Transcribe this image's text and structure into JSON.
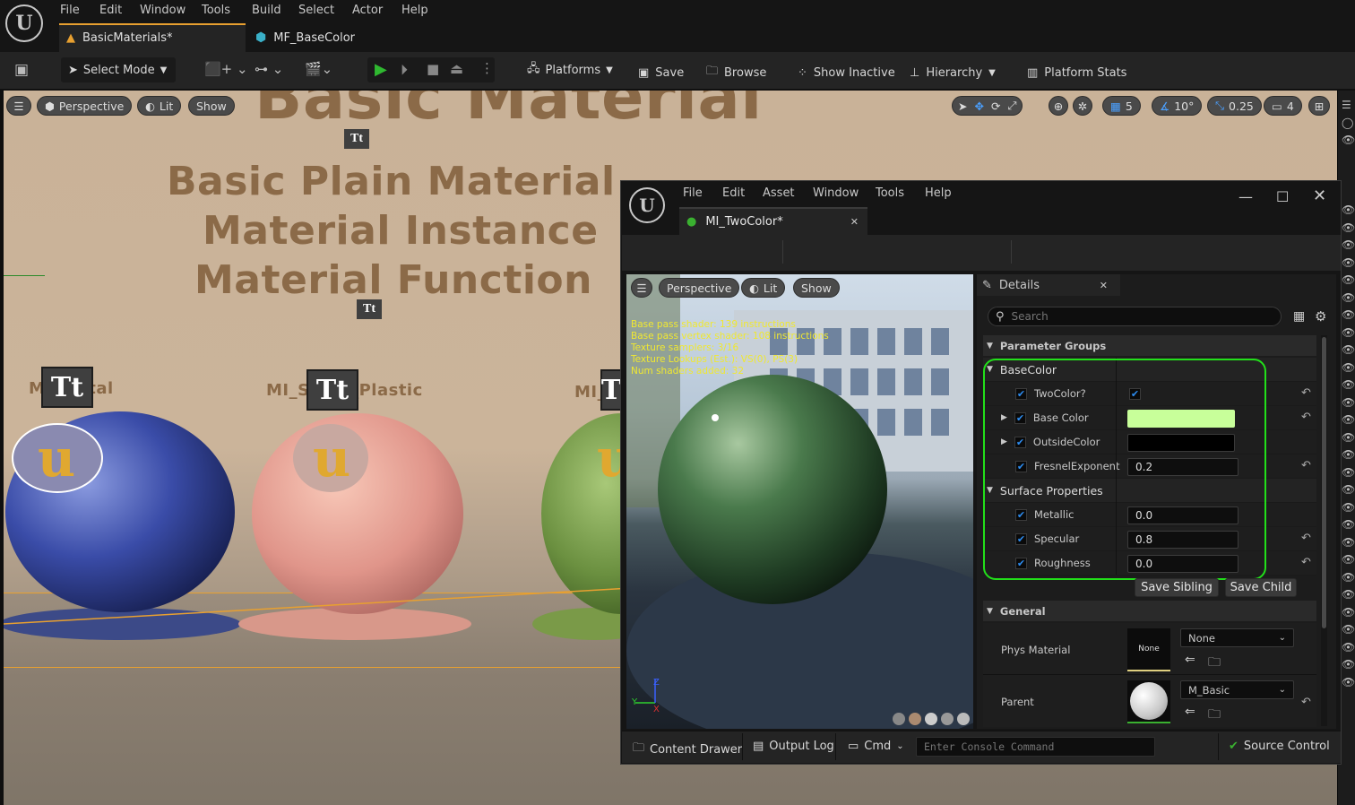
{
  "app": {
    "menu": [
      "File",
      "Edit",
      "Window",
      "Tools",
      "Build",
      "Select",
      "Actor",
      "Help"
    ],
    "tabs": [
      {
        "label": "BasicMaterials*"
      },
      {
        "label": "MF_BaseColor"
      }
    ]
  },
  "toolbar": {
    "select_mode": "Select Mode",
    "platforms": "Platforms"
  },
  "viewport": {
    "perspective": "Perspective",
    "lit": "Lit",
    "show": "Show",
    "snap_grid": "5",
    "snap_angle": "10°",
    "snap_scale": "0.25",
    "camera_speed": "4",
    "scene": {
      "heading": "Basic Material",
      "lines": [
        "Basic Plain Material",
        "Material Instance",
        "Material Function"
      ],
      "labels": [
        "MI_Metal",
        "MI_Shiny_Plastic",
        "MI_T"
      ]
    }
  },
  "material_editor": {
    "menu": [
      "File",
      "Edit",
      "Asset",
      "Window",
      "Tools",
      "Help"
    ],
    "tab": "MI_TwoColor*",
    "toolbar": {
      "save": "Save",
      "browse": "Browse",
      "show_inactive": "Show Inactive",
      "hierarchy": "Hierarchy",
      "platform_stats": "Platform Stats"
    },
    "preview": {
      "perspective": "Perspective",
      "lit": "Lit",
      "show": "Show",
      "stats": [
        "Base pass shader: 139 instructions",
        "Base pass vertex shader: 108 instructions",
        "Texture samplers: 3/16",
        "Texture Lookups (Est.): VS(0), PS(3)",
        "Num shaders added: 32"
      ]
    },
    "details": {
      "title": "Details",
      "search_placeholder": "Search",
      "parameter_groups": "Parameter Groups",
      "basecolor_group": "BaseColor",
      "params": [
        {
          "name": "TwoColor?",
          "value": ""
        },
        {
          "name": "Base Color",
          "value": ""
        },
        {
          "name": "OutsideColor",
          "value": ""
        },
        {
          "name": "FresnelExponent",
          "value": "0.2"
        }
      ],
      "surface_group": "Surface Properties",
      "surface": [
        {
          "name": "Metallic",
          "value": "0.0"
        },
        {
          "name": "Specular",
          "value": "0.8"
        },
        {
          "name": "Roughness",
          "value": "0.0"
        }
      ],
      "save_sibling": "Save Sibling",
      "save_child": "Save Child",
      "general": "General",
      "phys_material": "Phys Material",
      "phys_thumb": "None",
      "phys_value": "None",
      "parent": "Parent",
      "parent_value": "M_Basic"
    },
    "bottom": {
      "content_drawer": "Content Drawer",
      "output_log": "Output Log",
      "cmd": "Cmd",
      "console_placeholder": "Enter Console Command",
      "source_control": "Source Control"
    },
    "colors": {
      "base_color": "#c8ff9a",
      "outside_color": "#000000",
      "highlight": "#22e01a",
      "accent": "#2d8cf0"
    }
  }
}
